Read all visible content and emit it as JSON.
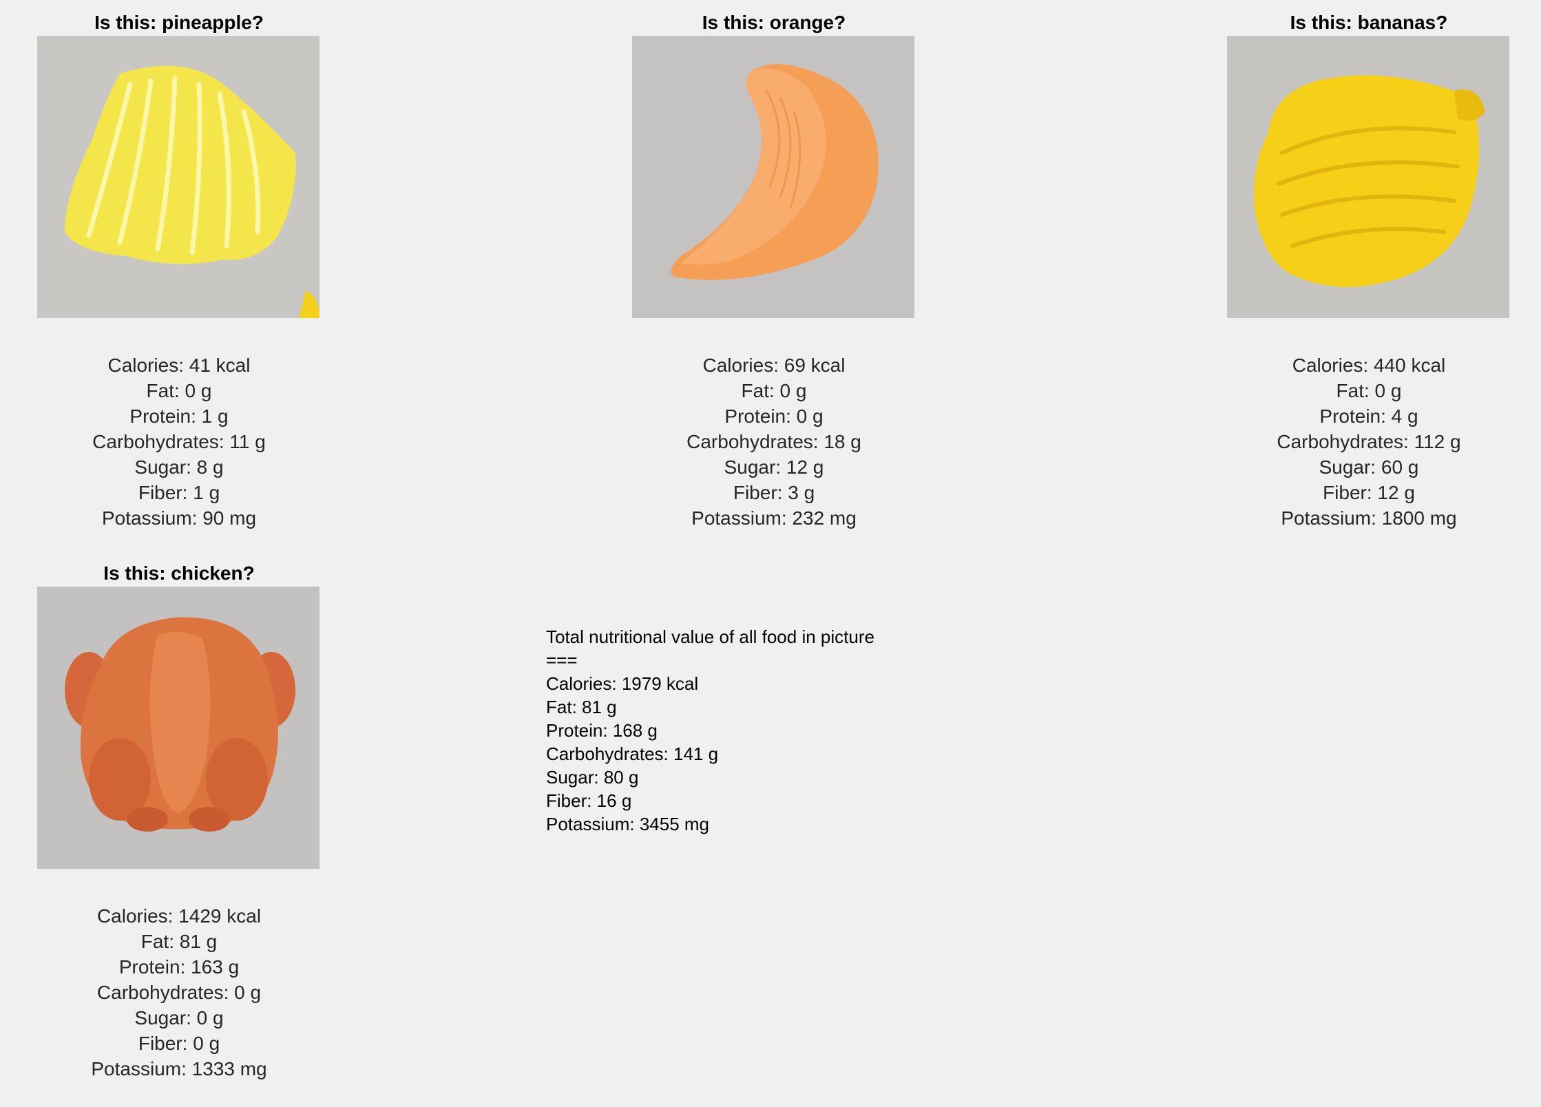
{
  "panels": [
    {
      "title": "Is this: pineapple?",
      "image_subject": "pineapple",
      "nutrition": [
        "Calories: 41 kcal",
        "Fat: 0 g",
        "Protein: 1 g",
        "Carbohydrates: 11 g",
        "Sugar: 8 g",
        "Fiber: 1 g",
        "Potassium: 90 mg"
      ]
    },
    {
      "title": "Is this: orange?",
      "image_subject": "orange",
      "nutrition": [
        "Calories: 69 kcal",
        "Fat: 0 g",
        "Protein: 0 g",
        "Carbohydrates: 18 g",
        "Sugar: 12 g",
        "Fiber: 3 g",
        "Potassium: 232 mg"
      ]
    },
    {
      "title": "Is this: bananas?",
      "image_subject": "bananas",
      "nutrition": [
        "Calories: 440 kcal",
        "Fat: 0 g",
        "Protein: 4 g",
        "Carbohydrates: 112 g",
        "Sugar: 60 g",
        "Fiber: 12 g",
        "Potassium: 1800 mg"
      ]
    },
    {
      "title": "Is this: chicken?",
      "image_subject": "chicken",
      "nutrition": [
        "Calories: 1429 kcal",
        "Fat: 81 g",
        "Protein: 163 g",
        "Carbohydrates: 0 g",
        "Sugar: 0 g",
        "Fiber: 0 g",
        "Potassium: 1333 mg"
      ]
    }
  ],
  "total": {
    "heading": "Total nutritional value of all food in picture",
    "separator": "===",
    "lines": [
      "Calories: 1979 kcal",
      "Fat: 81 g",
      "Protein: 168 g",
      "Carbohydrates: 141 g",
      "Sugar: 80 g",
      "Fiber: 16 g",
      "Potassium: 3455 mg"
    ]
  },
  "colors": {
    "background": "#f0f0f0",
    "photo_backdrop": "#c8c6c3",
    "pineapple": "#f5ea5a",
    "orange": "#f7a05a",
    "bananas": "#f7d21c",
    "chicken": "#d9703a"
  }
}
